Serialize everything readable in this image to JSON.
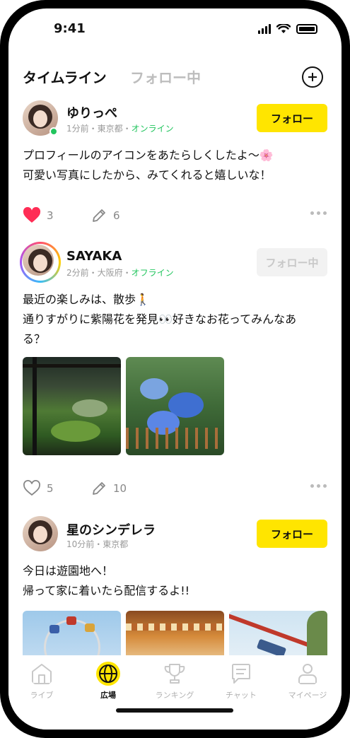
{
  "status_bar": {
    "time": "9:41"
  },
  "header": {
    "tabs": [
      {
        "label": "タイムライン",
        "active": true
      },
      {
        "label": "フォロー中",
        "active": false
      }
    ]
  },
  "posts": [
    {
      "name": "ゆりっぺ",
      "time_location": "1分前・東京都・",
      "status": "オンライン",
      "follow_label": "フォロー",
      "text_lines": [
        "プロフィールのアイコンをあたらしくしたよ〜🌸",
        "可愛い写真にしたから、みてくれると嬉しいな！"
      ],
      "likes": "3",
      "comments": "6",
      "liked": true
    },
    {
      "name": "SAYAKA",
      "time_location": "2分前・大阪府・",
      "status": "オフライン",
      "follow_label": "フォロー中",
      "text_lines": [
        "最近の楽しみは、散歩🚶",
        "通りすがりに紫陽花を発見👀好きなお花ってみんなあ",
        "る？"
      ],
      "likes": "5",
      "comments": "10",
      "liked": false
    },
    {
      "name": "星のシンデレラ",
      "time_location": "10分前・東京都",
      "status": "",
      "follow_label": "フォロー",
      "text_lines": [
        "今日は遊園地へ！",
        "帰って家に着いたら配信するよ!!"
      ]
    }
  ],
  "nav": [
    {
      "label": "ライブ",
      "icon": "house-icon",
      "active": false
    },
    {
      "label": "広場",
      "icon": "globe-icon",
      "active": true
    },
    {
      "label": "ランキング",
      "icon": "trophy-icon",
      "active": false
    },
    {
      "label": "チャット",
      "icon": "chat-icon",
      "active": false
    },
    {
      "label": "マイページ",
      "icon": "user-icon",
      "active": false
    }
  ],
  "colors": {
    "accent": "#ffe500",
    "online": "#22c55e",
    "like": "#ff2d55"
  }
}
